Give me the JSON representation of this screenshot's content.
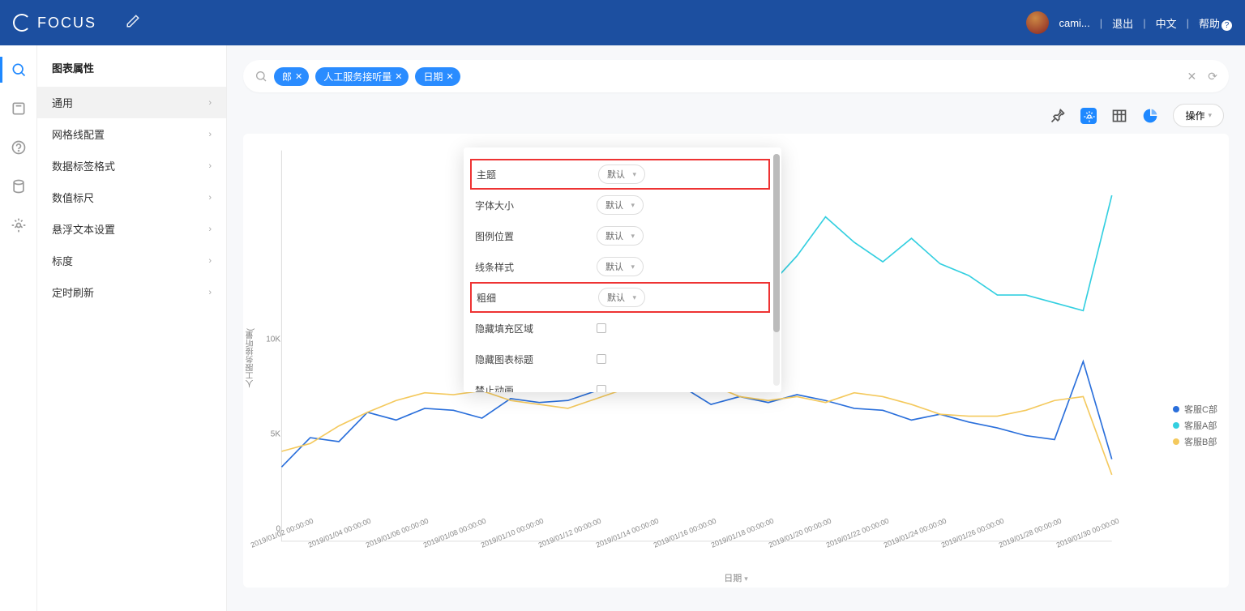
{
  "header": {
    "brand": "FOCUS",
    "user": "cami...",
    "logout": "退出",
    "lang": "中文",
    "help": "帮助"
  },
  "sidepanel": {
    "title": "图表属性",
    "items": [
      "通用",
      "网格线配置",
      "数据标签格式",
      "数值标尺",
      "悬浮文本设置",
      "标度",
      "定时刷新"
    ]
  },
  "pills": {
    "a": "郎",
    "b": "人工服务接听量",
    "c": "日期"
  },
  "toolbar": {
    "actions": "操作"
  },
  "popover": {
    "rows": {
      "theme": {
        "label": "主题",
        "value": "默认"
      },
      "fontsize": {
        "label": "字体大小",
        "value": "默认"
      },
      "legendpos": {
        "label": "图例位置",
        "value": "默认"
      },
      "linestyle": {
        "label": "线条样式",
        "value": "默认"
      },
      "thickness": {
        "label": "粗细",
        "value": "默认"
      },
      "hidefill": {
        "label": "隐藏填充区域"
      },
      "hideTitle": {
        "label": "隐藏图表标题"
      },
      "noAnim": {
        "label": "禁止动画"
      }
    }
  },
  "chart_data": {
    "type": "line",
    "ylabel": "人工服务接听量(",
    "xlabel": "日期",
    "ylim": [
      0,
      20000
    ],
    "yticks": [
      {
        "v": 0,
        "l": "0"
      },
      {
        "v": 5000,
        "l": "5K"
      },
      {
        "v": 10000,
        "l": "10K"
      }
    ],
    "categories": [
      "2019/01/02 00:00:00",
      "2019/01/04 00:00:00",
      "2019/01/06 00:00:00",
      "2019/01/08 00:00:00",
      "2019/01/10 00:00:00",
      "2019/01/12 00:00:00",
      "2019/01/14 00:00:00",
      "2019/01/16 00:00:00",
      "2019/01/18 00:00:00",
      "2019/01/20 00:00:00",
      "2019/01/22 00:00:00",
      "2019/01/24 00:00:00",
      "2019/01/26 00:00:00",
      "2019/01/28 00:00:00",
      "2019/01/30 00:00:00"
    ],
    "series": [
      {
        "name": "客服C部",
        "color": "#2a6fdb",
        "values": [
          3800,
          5300,
          5100,
          6600,
          6200,
          6800,
          6700,
          6300,
          7300,
          7100,
          7200,
          7700,
          7800,
          8100,
          7900,
          7000,
          7400,
          7100,
          7500,
          7200,
          6800,
          6700,
          6200,
          6500,
          6100,
          5800,
          5400,
          5200,
          9200,
          4200
        ]
      },
      {
        "name": "客服A部",
        "color": "#33cfe0",
        "values": [
          null,
          null,
          null,
          null,
          null,
          null,
          null,
          14900,
          13400,
          14800,
          17000,
          19700,
          18900,
          18100,
          14400,
          13300,
          13400,
          13000,
          14600,
          16600,
          15300,
          14300,
          15500,
          14200,
          13600,
          12600,
          12600,
          12200,
          11800,
          17700
        ]
      },
      {
        "name": "客服B部",
        "color": "#f4c95d",
        "values": [
          4600,
          5000,
          5900,
          6600,
          7200,
          7600,
          7500,
          7700,
          7200,
          7000,
          6800,
          7300,
          7800,
          8400,
          7700,
          8000,
          7400,
          7200,
          7400,
          7100,
          7600,
          7400,
          7000,
          6500,
          6400,
          6400,
          6700,
          7200,
          7400,
          3400
        ]
      }
    ]
  },
  "legend": {
    "c": "客服C部",
    "a": "客服A部",
    "b": "客服B部"
  }
}
